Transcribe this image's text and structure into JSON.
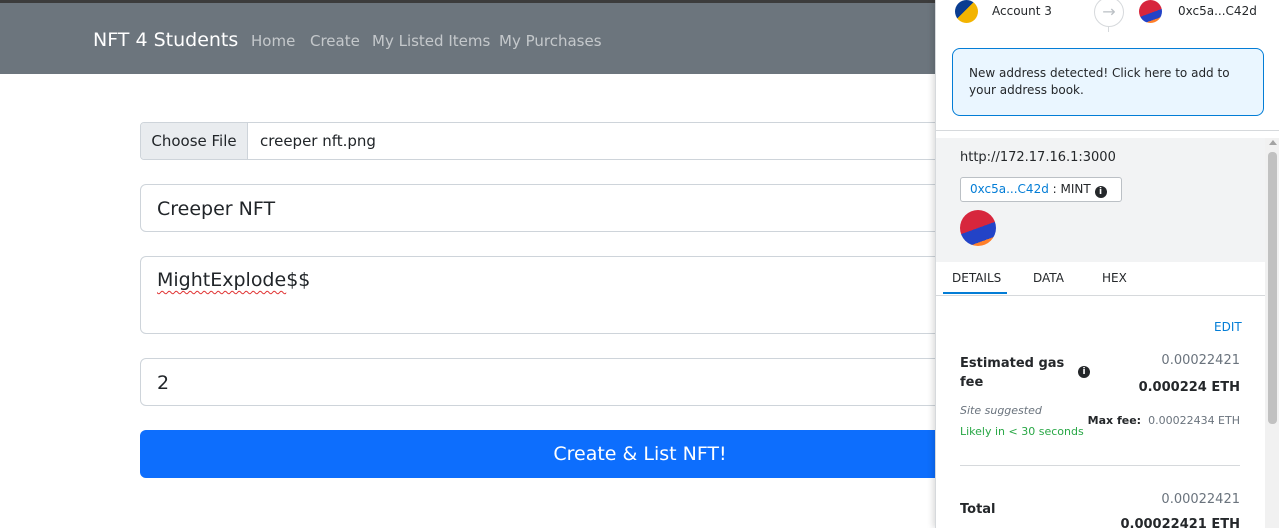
{
  "navbar": {
    "brand": "NFT 4 Students",
    "links": [
      "Home",
      "Create",
      "My Listed Items",
      "My Purchases"
    ]
  },
  "form": {
    "file_button": "Choose File",
    "file_name": "creeper nft.png",
    "name_value": "Creeper NFT",
    "description_value": "MightExplode$$",
    "description_underlined": "MightExplode",
    "description_rest": "$$",
    "price_value": "2",
    "submit_label": "Create & List NFT!"
  },
  "metamask": {
    "from_account": "Account 3",
    "to_address": "0xc5a...C42d",
    "alert_text": "New address detected! Click here to add to your address book.",
    "origin": "http://172.17.16.1:3000",
    "contract_address": "0xc5a...C42d",
    "method": ": MINT",
    "tabs": [
      "DETAILS",
      "DATA",
      "HEX"
    ],
    "active_tab": "DETAILS",
    "edit_label": "EDIT",
    "gas_label": "Estimated gas fee",
    "gas_amount": "0.00022421",
    "gas_eth": "0.000224 ETH",
    "site_suggested": "Site suggested",
    "likely": "Likely in < 30 seconds",
    "max_fee_label": "Max fee:",
    "max_fee_value": "0.00022434 ETH",
    "total_label": "Total",
    "total_amount": "0.00022421",
    "total_eth": "0.00022421 ETH"
  },
  "colors": {
    "navbar": "#6c757d",
    "primary_button": "#0d6efd",
    "metamask_blue": "#037dd6",
    "success_green": "#28a745"
  }
}
